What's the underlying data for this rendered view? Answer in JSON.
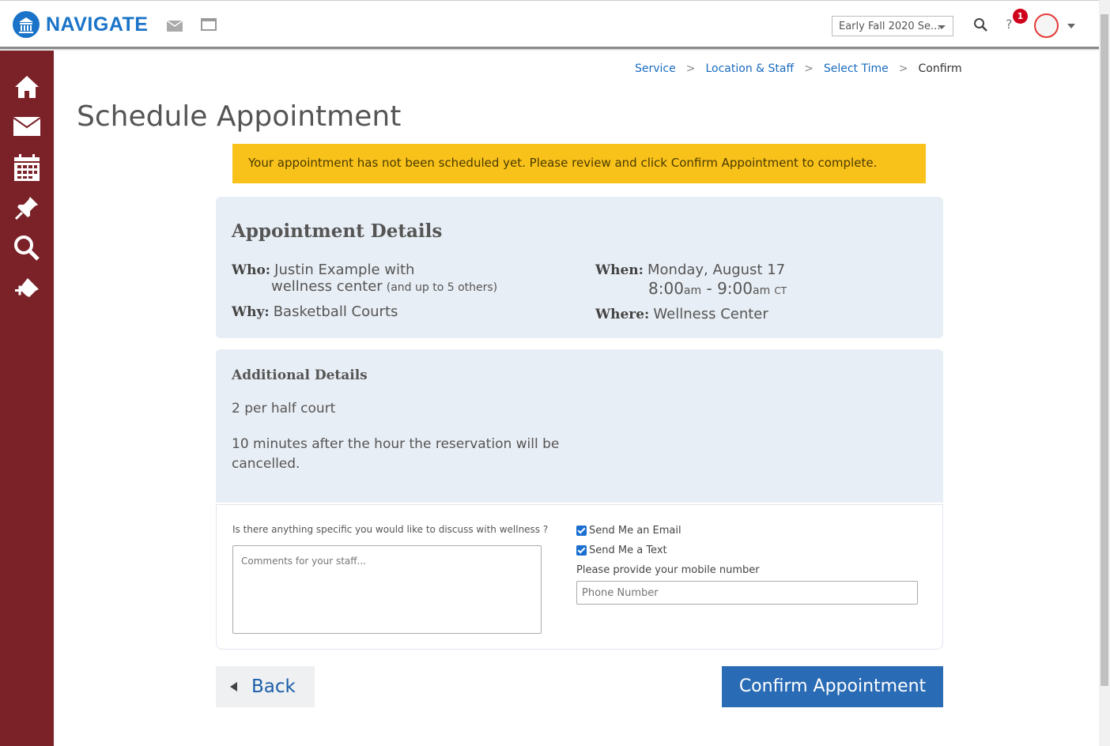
{
  "header": {
    "brand": "NAVIGATE",
    "term_select": "Early Fall 2020 Se...",
    "help_label": "?",
    "notification_count": "1"
  },
  "breadcrumb": {
    "items": [
      "Service",
      "Location & Staff",
      "Select Time"
    ],
    "current": "Confirm",
    "separator": ">"
  },
  "page": {
    "title": "Schedule Appointment",
    "alert": "Your appointment has not been scheduled yet. Please review and click Confirm Appointment to complete."
  },
  "details": {
    "title": "Appointment Details",
    "who_label": "Who:",
    "who_value": "Justin Example with",
    "who_value2": "wellness center",
    "who_note": "(and up to 5 others)",
    "why_label": "Why:",
    "why_value": "Basketball Courts",
    "when_label": "When:",
    "when_date": "Monday, August 17",
    "when_start": "8:00",
    "when_start_suffix": "am",
    "when_dash": " - ",
    "when_end": "9:00",
    "when_end_suffix": "am",
    "when_tz": "CT",
    "where_label": "Where:",
    "where_value": "Wellness Center"
  },
  "additional": {
    "title": "Additional Details",
    "line1": "2 per half court",
    "line2": "10 minutes after the hour the reservation will be cancelled."
  },
  "form": {
    "question": "Is there anything specific you would like to discuss with wellness ?",
    "comments_placeholder": "Comments for your staff...",
    "send_email_label": "Send Me an Email",
    "send_text_label": "Send Me a Text",
    "mobile_label": "Please provide your mobile number",
    "phone_placeholder": "Phone Number"
  },
  "buttons": {
    "back": "Back",
    "confirm": "Confirm Appointment"
  },
  "colors": {
    "sidebar": "#7b2128",
    "brand": "#1a73c8",
    "alert": "#f9c21b",
    "confirm": "#2a6bb5"
  }
}
